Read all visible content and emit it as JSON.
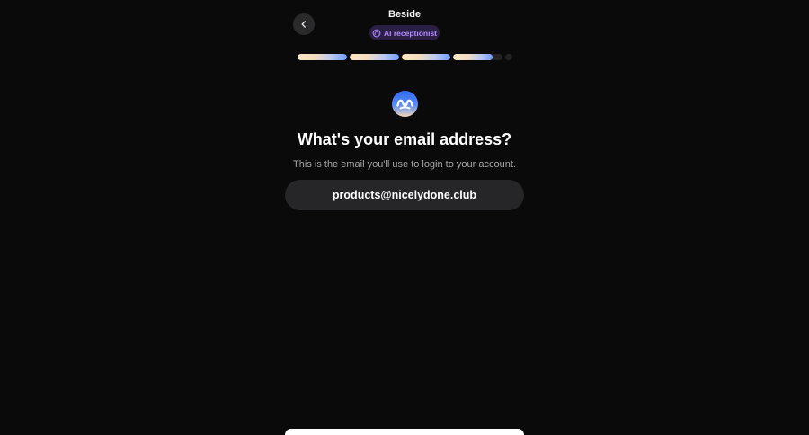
{
  "header": {
    "title": "Beside",
    "badge": {
      "label": "AI receptionist",
      "icon": "headset-icon",
      "color": "#b48cff"
    },
    "back_icon": "chevron-left-icon"
  },
  "progress": {
    "steps": [
      {
        "fill": 1.0
      },
      {
        "fill": 1.0
      },
      {
        "fill": 1.0
      },
      {
        "fill": 0.8
      },
      {
        "fill": 0.0
      }
    ],
    "accent_gradient": [
      "#fde6c4",
      "#6f9bff"
    ]
  },
  "main": {
    "logo": "beside-logo-icon",
    "headline": "What's your email address?",
    "subtitle": "This is the email you'll use to login to your account.",
    "email_value": "products@nicelydone.club"
  },
  "colors": {
    "background": "#0a0a0a",
    "field": "#262628",
    "badge_bg": "#2b1f45"
  }
}
